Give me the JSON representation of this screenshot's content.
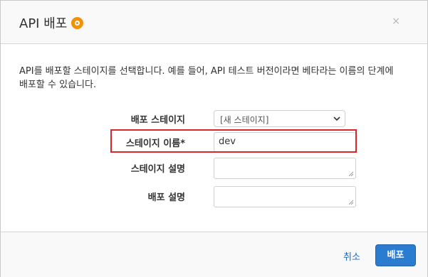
{
  "dialog": {
    "title": "API 배포",
    "close": "×",
    "description": "API를 배포할 스테이지를 선택합니다. 예를 들어, API 테스트 버전이라면 베타라는 이름의 단계에 배포할 수 있습니다."
  },
  "form": {
    "stage_label": "배포 스테이지",
    "stage_value": "[새 스테이지]",
    "stage_name_label": "스테이지 이름*",
    "stage_name_value": "dev",
    "stage_desc_label": "스테이지 설명",
    "deploy_desc_label": "배포 설명"
  },
  "footer": {
    "cancel": "취소",
    "deploy": "배포"
  },
  "colors": {
    "accent": "#2a7cd1",
    "highlight": "#d9262a",
    "info_badge": "#f29106"
  },
  "icons": {
    "title_info": "info-icon",
    "close": "close-icon",
    "select": "chevron-down-icon"
  }
}
